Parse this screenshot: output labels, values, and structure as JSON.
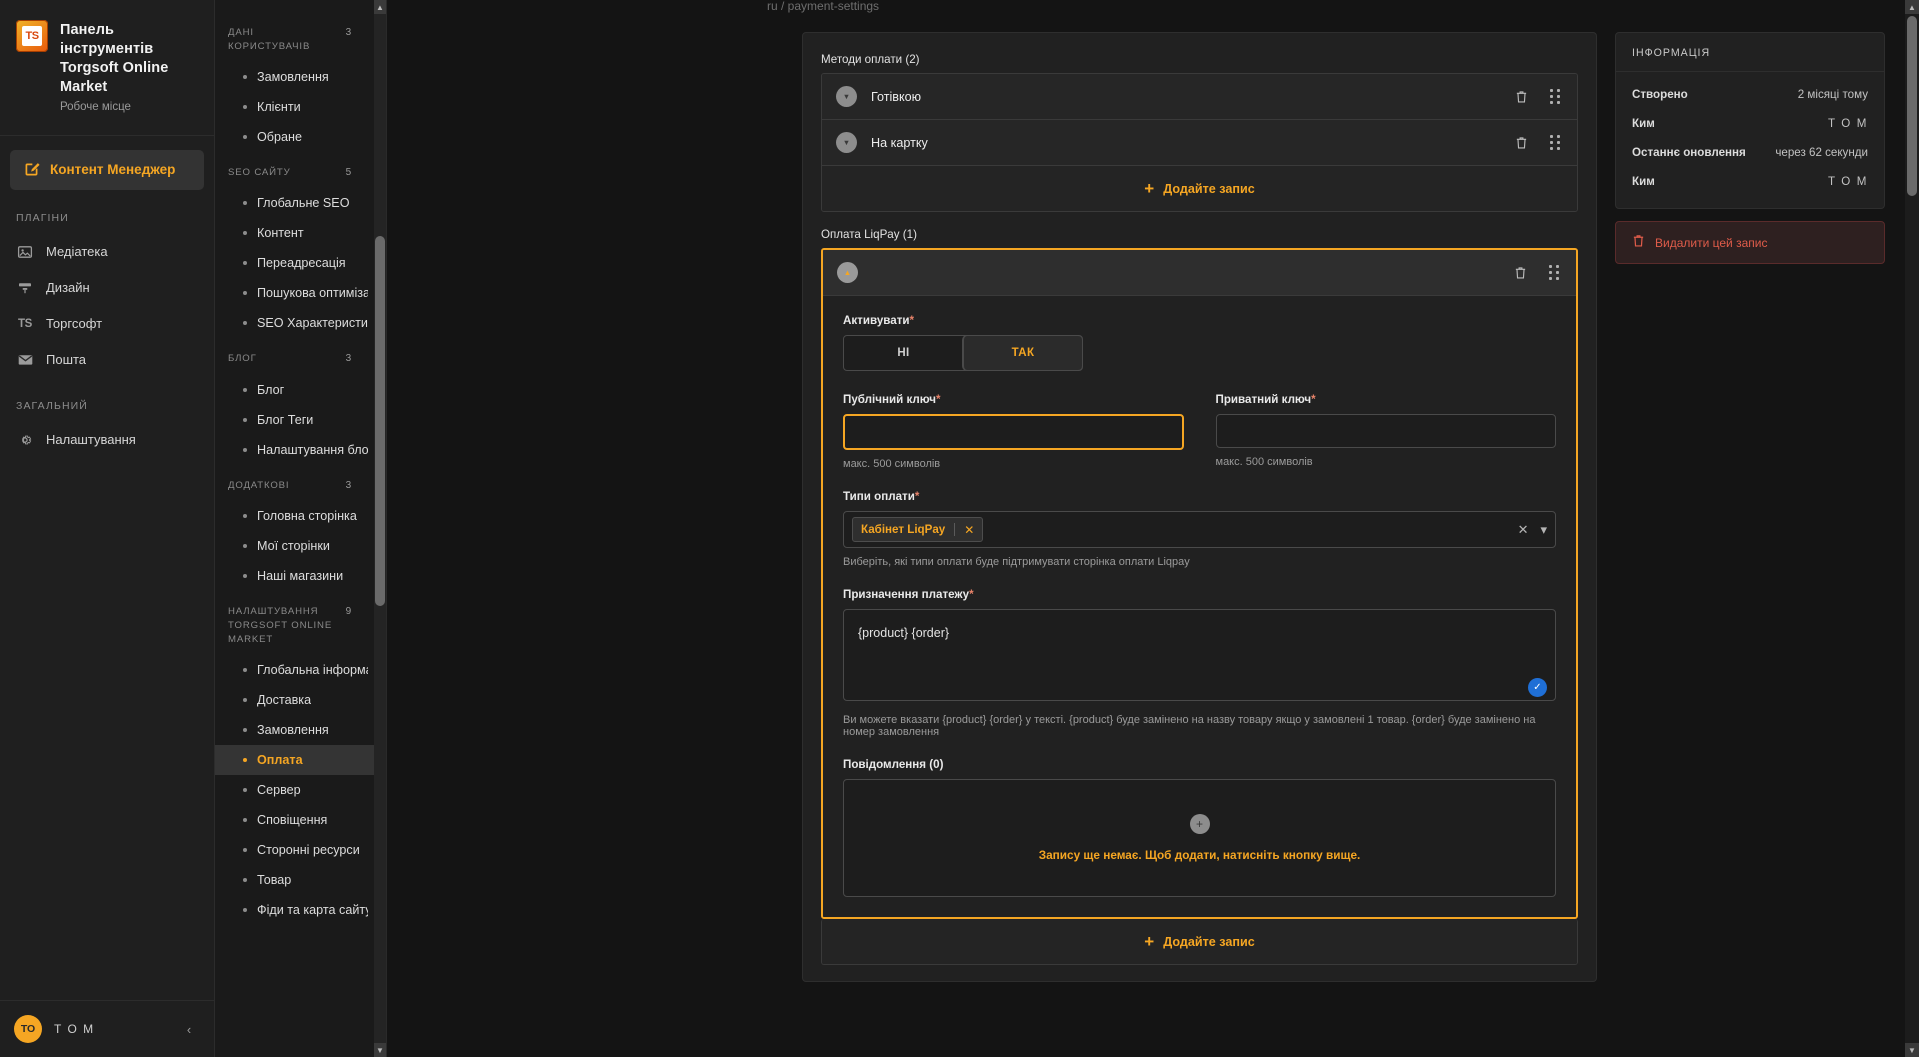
{
  "brand": {
    "title": "Панель інструментів Torgsoft Online Market",
    "subtitle": "Робоче місце",
    "logo_text": "TS"
  },
  "active_app": {
    "label": "Контент Менеджер",
    "icon": "edit-square-icon"
  },
  "sidebar": {
    "groups": [
      {
        "title": "ПЛАГІНИ",
        "items": [
          {
            "label": "Медіатека",
            "icon": "image-icon"
          },
          {
            "label": "Дизайн",
            "icon": "layout-icon"
          },
          {
            "label": "Торгсофт",
            "icon": "ts-icon"
          },
          {
            "label": "Пошта",
            "icon": "mail-icon"
          }
        ]
      },
      {
        "title": "ЗАГАЛЬНИЙ",
        "items": [
          {
            "label": "Налаштування",
            "icon": "gear-icon"
          }
        ]
      }
    ],
    "footer": {
      "user": "T O M",
      "collapse": "‹"
    }
  },
  "secondary_nav": {
    "groups": [
      {
        "title": "ДАНІ КОРИСТУВАЧІВ",
        "count": "3",
        "items": [
          {
            "label": "Замовлення",
            "active": false
          },
          {
            "label": "Клієнти",
            "active": false
          },
          {
            "label": "Обране",
            "active": false
          }
        ]
      },
      {
        "title": "SEO САЙТУ",
        "count": "5",
        "items": [
          {
            "label": "Глобальне SEO",
            "active": false
          },
          {
            "label": "Контент",
            "active": false
          },
          {
            "label": "Переадресація",
            "active": false
          },
          {
            "label": "Пошукова оптимізація",
            "active": false
          },
          {
            "label": "SEO Характеристик",
            "active": false
          }
        ]
      },
      {
        "title": "БЛОГ",
        "count": "3",
        "items": [
          {
            "label": "Блог",
            "active": false
          },
          {
            "label": "Блог Теги",
            "active": false
          },
          {
            "label": "Налаштування блогу",
            "active": false
          }
        ]
      },
      {
        "title": "ДОДАТКОВІ",
        "count": "3",
        "items": [
          {
            "label": "Головна сторінка",
            "active": false
          },
          {
            "label": "Мої сторінки",
            "active": false
          },
          {
            "label": "Наші магазини",
            "active": false
          }
        ]
      },
      {
        "title": "НАЛАШТУВАННЯ TORGSOFT ONLINE MARKET",
        "count": "9",
        "items": [
          {
            "label": "Глобальна інформація",
            "active": false
          },
          {
            "label": "Доставка",
            "active": false
          },
          {
            "label": "Замовлення",
            "active": false
          },
          {
            "label": "Оплата",
            "active": true
          },
          {
            "label": "Сервер",
            "active": false
          },
          {
            "label": "Сповіщення",
            "active": false
          },
          {
            "label": "Сторонні ресурси",
            "active": false
          },
          {
            "label": "Товар",
            "active": false
          },
          {
            "label": "Фіди та карта сайту",
            "active": false
          }
        ]
      }
    ]
  },
  "breadcrumb": "ru / payment-settings",
  "payment_methods": {
    "label": "Методи оплати (2)",
    "rows": [
      {
        "title": "Готівкою"
      },
      {
        "title": "На картку"
      }
    ],
    "add_label": "Додайте запис"
  },
  "liqpay": {
    "label": "Оплата LiqPay (1)",
    "activate": {
      "label": "Активувати",
      "required": "*",
      "options": [
        {
          "label": "НІ",
          "selected": false
        },
        {
          "label": "ТАК",
          "selected": true
        }
      ]
    },
    "public_key": {
      "label": "Публічний ключ",
      "required": "*",
      "value": "",
      "hint": "макс. 500 символів"
    },
    "private_key": {
      "label": "Приватний ключ",
      "required": "*",
      "value": "",
      "hint": "макс. 500 символів"
    },
    "payment_types": {
      "label": "Типи оплати",
      "required": "*",
      "chips": [
        {
          "label": "Кабінет LiqPay",
          "remove": "✕"
        }
      ],
      "clear": "✕",
      "chevron": "▾",
      "hint": "Виберіть, які типи оплати буде підтримувати сторінка оплати Liqpay"
    },
    "purpose": {
      "label": "Призначення платежу",
      "required": "*",
      "value": "{product} {order}",
      "hint": "Ви можете вказати {product} {order} у тексті. {product} буде замінено на назву товару якщо у замовлені 1 товар. {order} буде замінено на номер замовлення",
      "check": "✓"
    },
    "messages": {
      "label": "Повідомлення (0)",
      "empty_text": "Запису ще немає. Щоб додати, натисніть кнопку вище.",
      "add_glyph": "+"
    },
    "add_label": "Додайте запис"
  },
  "info_panel": {
    "title": "ІНФОРМАЦІЯ",
    "rows": [
      {
        "key": "Створено",
        "value": "2 місяці тому",
        "user": false
      },
      {
        "key": "Ким",
        "value": "T O M",
        "user": true
      },
      {
        "key": "Останнє оновлення",
        "value": "через 62 секунди",
        "user": false
      },
      {
        "key": "Ким",
        "value": "T O M",
        "user": true
      }
    ],
    "delete_label": "Видалити цей запис",
    "delete_icon": "trash-icon"
  },
  "colors": {
    "accent": "#f5a623",
    "danger": "#e05c4a",
    "bg": "#141414",
    "panel": "#212121"
  }
}
